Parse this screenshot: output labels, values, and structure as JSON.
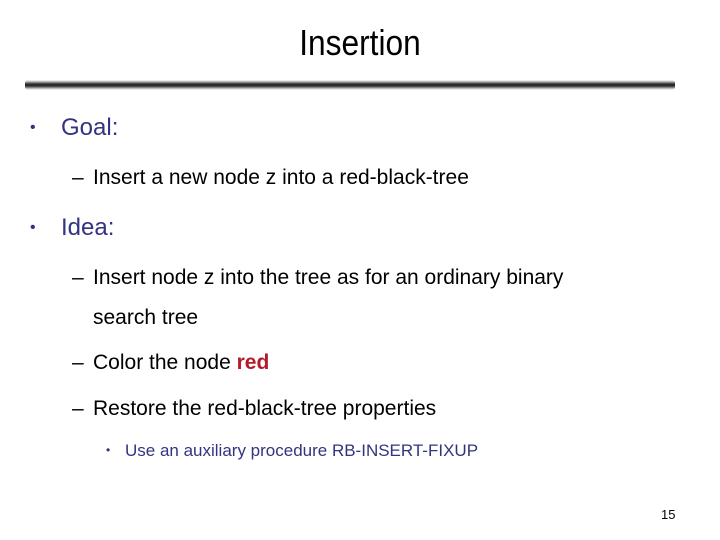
{
  "slide": {
    "title": "Insertion",
    "page_number": "15",
    "accent_colors": {
      "bullet_text": "#333380",
      "emphasis_red": "#b31b2b"
    },
    "bullets": [
      {
        "label": "Goal:",
        "marker": "•",
        "items": [
          {
            "marker": "–",
            "text": "Insert a new node z into a red-black-tree"
          }
        ]
      },
      {
        "label": "Idea:",
        "marker": "•",
        "items": [
          {
            "marker": "–",
            "text_line1": "Insert node z into the tree as for an ordinary binary",
            "text_line2": "search tree"
          },
          {
            "marker": "–",
            "text_prefix": "Color the node ",
            "text_emphasis": "red"
          },
          {
            "marker": "–",
            "text": "Restore the red-black-tree properties",
            "subitems": [
              {
                "marker": "•",
                "text": "Use an auxiliary procedure RB-INSERT-FIXUP"
              }
            ]
          }
        ]
      }
    ]
  }
}
